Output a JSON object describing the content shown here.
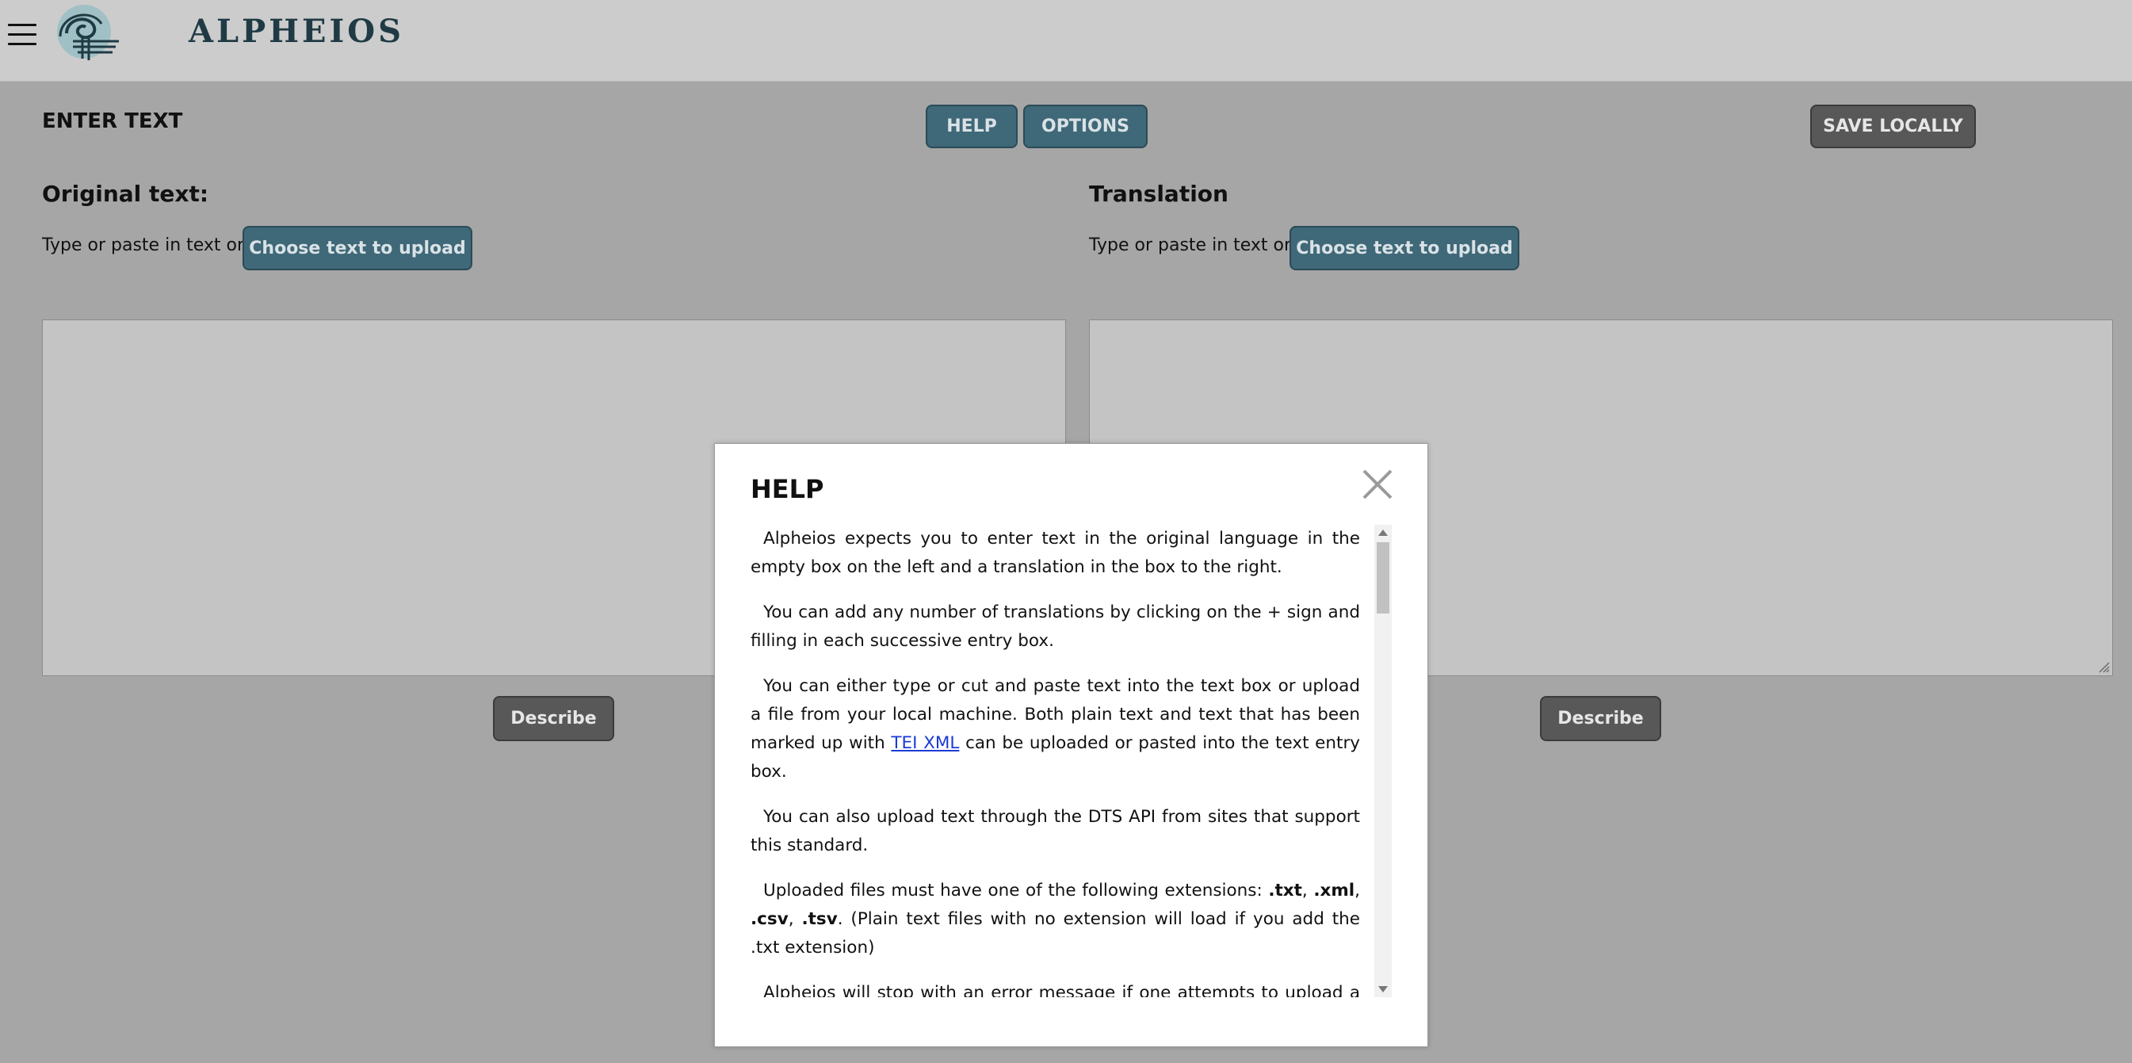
{
  "header": {
    "logo_text": "ALPHEIOS",
    "menu_icon": "hamburger-menu-icon"
  },
  "main": {
    "title": "ENTER TEXT",
    "help_label": "HELP",
    "options_label": "OPTIONS",
    "save_label": "SAVE LOCALLY",
    "original": {
      "heading": "Original text:",
      "type_label": "Type or paste in text or",
      "upload_label": "Choose text to upload",
      "describe_label": "Describe"
    },
    "translation": {
      "heading": "Translation",
      "type_label": "Type or paste in text or",
      "upload_label": "Choose text to upload",
      "describe_label": "Describe"
    }
  },
  "help_modal": {
    "title": "HELP",
    "p1": "Alpheios expects you to enter text in the original language in the empty box on the left and a translation in the box to the right.",
    "p2": "You can add any number of translations by clicking on the + sign and filling in each successive entry box.",
    "p3_before": "You can either type or cut and paste text into the text box or upload a file from your local machine. Both plain text and text that has been marked up with",
    "p3_link": "TEI XML",
    "p3_after": "can be uploaded or pasted into the text entry box.",
    "p4": "You can also upload text through the DTS API from sites that support this standard.",
    "p5_before": "Uploaded files must have one of the following extensions:",
    "ext1": ".txt",
    "ext2": ".xml",
    "ext3": ".csv",
    "ext4": ".tsv",
    "p5_after": ". (Plain text files with no extension will load if you add the .txt extension)",
    "p6": "Alpheios will stop with an error message if one attempts to upload a file with any other extension."
  },
  "colors": {
    "page_bg": "#a6a6a6",
    "header_bg": "#cccccc",
    "teal_button": "#3f6878",
    "dark_button": "#585858",
    "link": "#1a3bd6"
  }
}
